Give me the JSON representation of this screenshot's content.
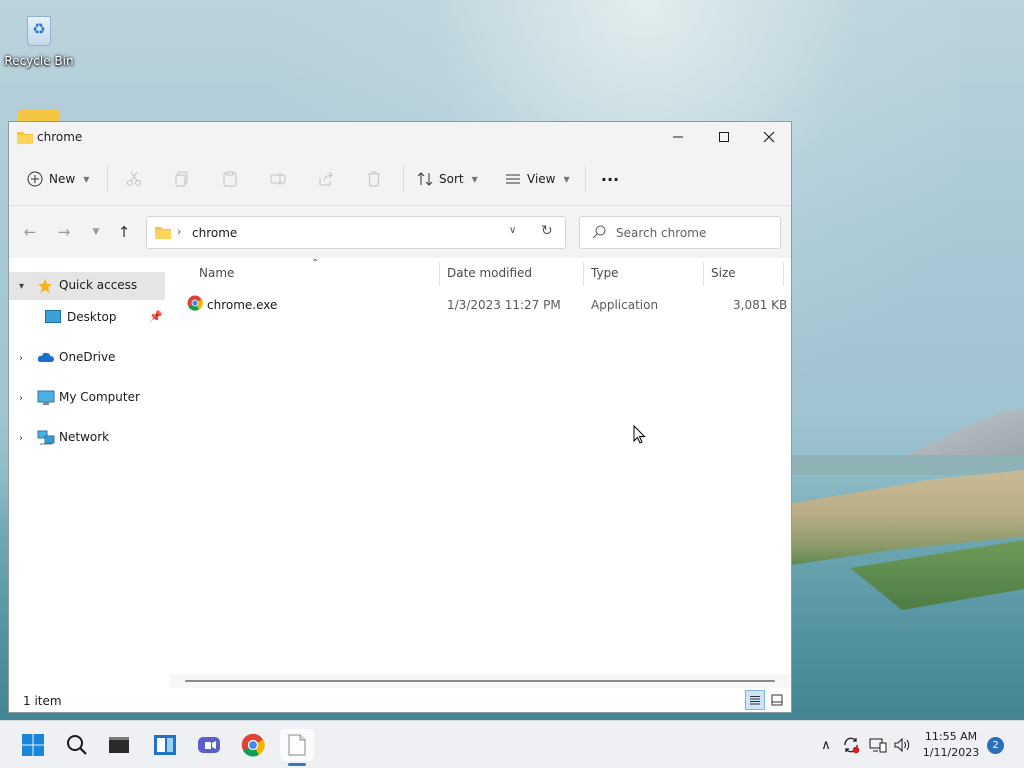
{
  "desktop": {
    "icons": [
      {
        "label": "Recycle Bin",
        "icon": "recycle-bin-icon"
      }
    ]
  },
  "window": {
    "title": "chrome",
    "controls": {
      "minimize": "minimize-icon",
      "maximize": "maximize-icon",
      "close": "close-icon"
    }
  },
  "toolbar": {
    "new_label": "New",
    "sort_label": "Sort",
    "view_label": "View",
    "more_label": "···",
    "disabled_actions": [
      "cut-icon",
      "copy-icon",
      "paste-icon",
      "rename-icon",
      "share-icon",
      "delete-icon"
    ]
  },
  "navigation": {
    "breadcrumb": [
      "chrome"
    ],
    "search_placeholder": "Search chrome"
  },
  "sidebar": {
    "items": [
      {
        "label": "Quick access",
        "icon": "star-icon",
        "expanded": true,
        "selected": true
      },
      {
        "label": "Desktop",
        "icon": "desktop-icon",
        "pinned": true
      },
      {
        "label": "OneDrive",
        "icon": "cloud-icon"
      },
      {
        "label": "My Computer",
        "icon": "computer-icon"
      },
      {
        "label": "Network",
        "icon": "network-icon"
      }
    ]
  },
  "file_list": {
    "columns": [
      "Name",
      "Date modified",
      "Type",
      "Size"
    ],
    "sort_column": "Name",
    "rows": [
      {
        "name": "chrome.exe",
        "date_modified": "1/3/2023 11:27 PM",
        "type": "Application",
        "size": "3,081 KB",
        "icon": "chrome-icon"
      }
    ]
  },
  "status": {
    "item_count": "1 item"
  },
  "taskbar": {
    "apps": [
      "windows-start-icon",
      "search-icon",
      "terminal-icon",
      "widgets-icon",
      "teams-icon",
      "chrome-icon",
      "notepad-icon"
    ],
    "active_app": "notepad-icon",
    "tray": [
      "chevron-up-icon",
      "sync-icon",
      "network-icon",
      "volume-icon"
    ],
    "time": "11:55 AM",
    "date": "1/11/2023",
    "notifications": "2"
  },
  "colors": {
    "accent": "#0067c0",
    "selected_sidebar": "#e5e5e5",
    "folder": "#f4c542"
  }
}
